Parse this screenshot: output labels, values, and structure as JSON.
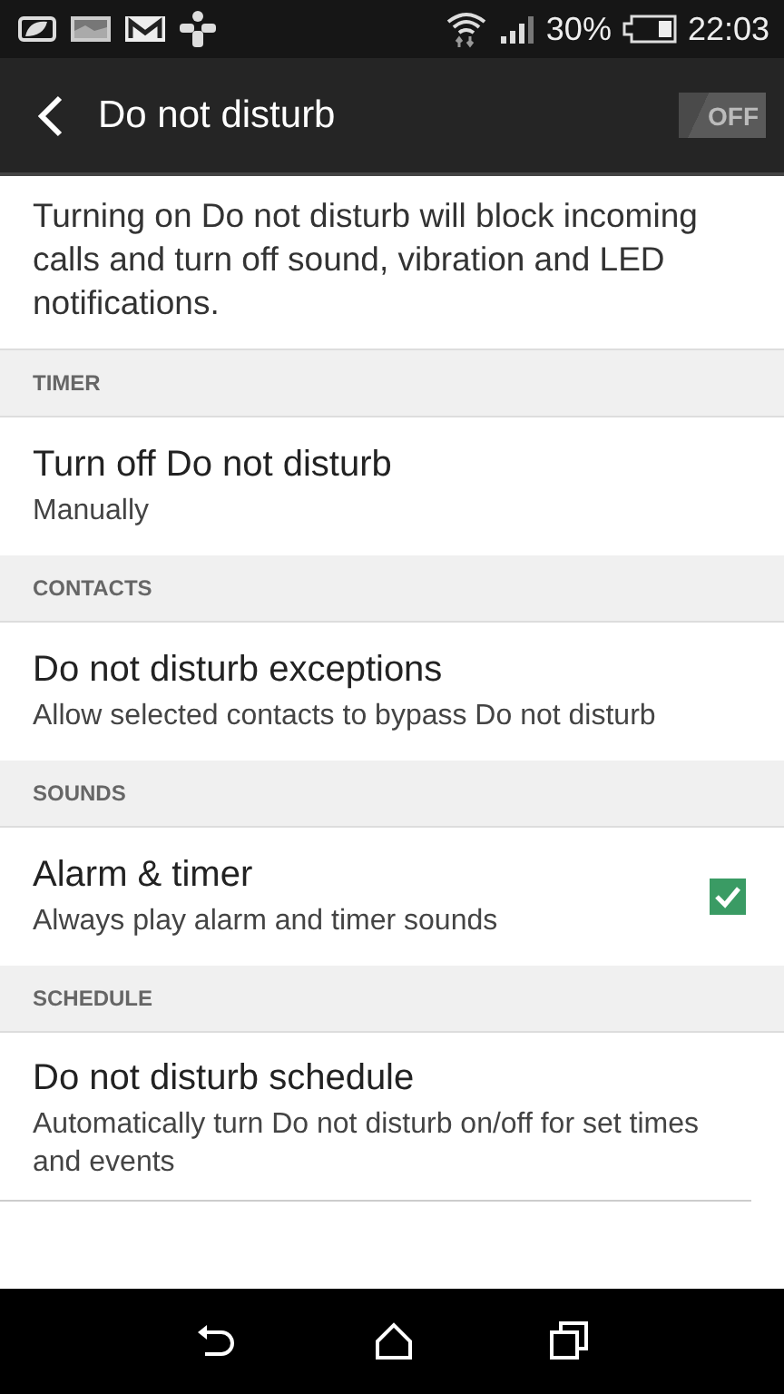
{
  "status_bar": {
    "battery_percent": "30%",
    "time": "22:03"
  },
  "app_bar": {
    "title": "Do not disturb",
    "toggle": {
      "label": "OFF",
      "on": false
    }
  },
  "description": "Turning on Do not disturb will block incoming calls and turn off sound, vibration and LED notifications.",
  "sections": [
    {
      "header": "TIMER",
      "items": [
        {
          "kind": "plain",
          "title": "Turn off Do not disturb",
          "subtitle": "Manually"
        }
      ]
    },
    {
      "header": "CONTACTS",
      "items": [
        {
          "kind": "plain",
          "title": "Do not disturb exceptions",
          "subtitle": "Allow selected contacts to bypass Do not disturb"
        }
      ]
    },
    {
      "header": "SOUNDS",
      "items": [
        {
          "kind": "checkbox",
          "title": "Alarm & timer",
          "subtitle": "Always play alarm and timer sounds",
          "checked": true
        }
      ]
    },
    {
      "header": "SCHEDULE",
      "items": [
        {
          "kind": "plain",
          "title": "Do not disturb schedule",
          "subtitle": "Automatically turn Do not disturb on/off for set times and events"
        }
      ]
    }
  ]
}
